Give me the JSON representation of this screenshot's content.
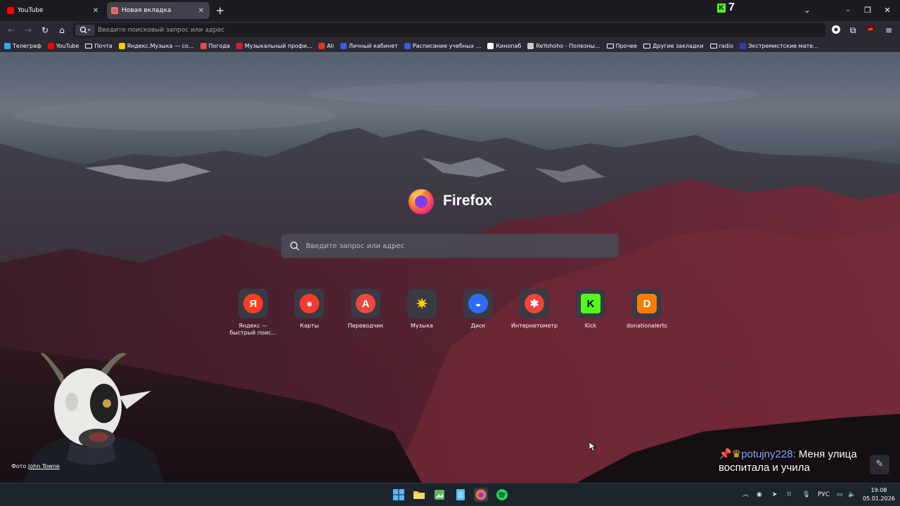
{
  "tabs": [
    {
      "label": "YouTube",
      "favicon_color": "#ff0000"
    },
    {
      "label": "Новая вкладка",
      "favicon_color": "#ff7139"
    }
  ],
  "kick_overlay": {
    "count": "7",
    "letter": "K"
  },
  "nav": {
    "url_placeholder": "Введите поисковый запрос или адрес"
  },
  "bookmarks": [
    {
      "label": "Телеграф",
      "icon": "#2aabee",
      "type": "site"
    },
    {
      "label": "YouTube",
      "icon": "#ff0000",
      "type": "site"
    },
    {
      "label": "Почта",
      "icon": "",
      "type": "folder"
    },
    {
      "label": "Яндекс.Музыка — со...",
      "icon": "#ffcc00",
      "type": "site"
    },
    {
      "label": "Погода",
      "icon": "#e64a4a",
      "type": "site"
    },
    {
      "label": "Музыкальный профи...",
      "icon": "#d11d2f",
      "type": "site"
    },
    {
      "label": "Ali",
      "icon": "#e43225",
      "type": "site"
    },
    {
      "label": "Личный кабинет",
      "icon": "#3b5bdb",
      "type": "site"
    },
    {
      "label": "Расписание учебных ...",
      "icon": "#3b5bdb",
      "type": "site"
    },
    {
      "label": "Кинопаб",
      "icon": "#ffffff",
      "type": "site"
    },
    {
      "label": "ReYohoho - Полезны...",
      "icon": "#cccccc",
      "type": "site"
    },
    {
      "label": "Прочее",
      "icon": "",
      "type": "folder"
    },
    {
      "label": "Другие закладки",
      "icon": "",
      "type": "folder"
    },
    {
      "label": "radio",
      "icon": "",
      "type": "folder"
    },
    {
      "label": "Экстремистские мате...",
      "icon": "#3a3aa8",
      "type": "site"
    }
  ],
  "newtab": {
    "brand": "Firefox",
    "search_placeholder": "Введите запрос или адрес",
    "shortcuts": [
      {
        "label": "Яндекс — быстрый поис...",
        "icon": "yandex-icon",
        "glyph": "Я",
        "color": "#fc3f1d"
      },
      {
        "label": "Карты",
        "icon": "maps-pin-icon",
        "glyph": "●",
        "color": "#f43b2f"
      },
      {
        "label": "Переводчик",
        "icon": "translate-icon",
        "glyph": "A",
        "color": "#e9493f"
      },
      {
        "label": "Музыка",
        "icon": "music-star-icon",
        "glyph": "✷",
        "color": "#3a3944"
      },
      {
        "label": "Диск",
        "icon": "disk-icon",
        "glyph": "◒",
        "color": "#2f6cf6"
      },
      {
        "label": "Интернетометр",
        "icon": "speedometer-icon",
        "glyph": "✱",
        "color": "#f0433a"
      },
      {
        "label": "Kick",
        "icon": "kick-icon",
        "glyph": "K",
        "color": "#53fc18"
      },
      {
        "label": "donationalerts",
        "icon": "donationalerts-icon",
        "glyph": "D",
        "color": "#f57d07"
      }
    ],
    "photo_credit_prefix": "Фото",
    "photo_credit_author": "John Towne"
  },
  "chat_overlay": {
    "user": "potujny228:",
    "message": "Меня улица воспитала и учила"
  },
  "taskbar": {
    "language": "РУС",
    "time": "19:08",
    "date": "05.01.2026"
  }
}
